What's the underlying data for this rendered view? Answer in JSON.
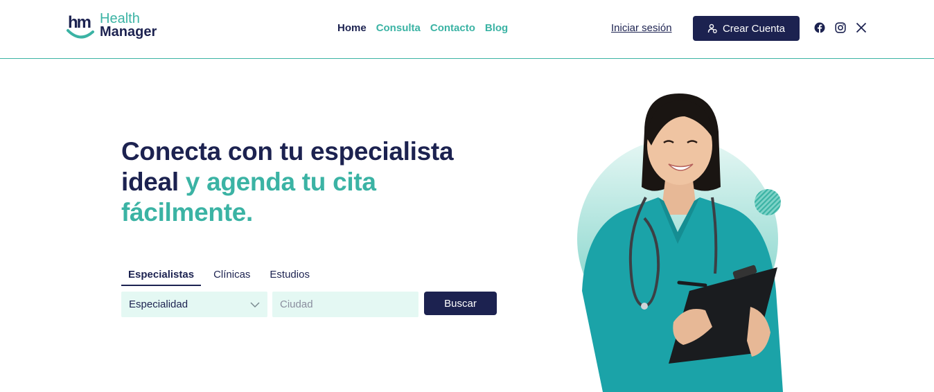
{
  "brand": {
    "line1": "Health",
    "line2": "Manager",
    "monogram": "hm"
  },
  "nav": {
    "items": [
      {
        "label": "Home",
        "active": true
      },
      {
        "label": "Consulta",
        "active": false
      },
      {
        "label": "Contacto",
        "active": false
      },
      {
        "label": "Blog",
        "active": false
      }
    ]
  },
  "auth": {
    "login_label": "Iniciar sesión",
    "signup_label": "Crear Cuenta",
    "signup_icon": "user-plus-icon"
  },
  "social": [
    {
      "name": "facebook-icon"
    },
    {
      "name": "instagram-icon"
    },
    {
      "name": "x-icon"
    }
  ],
  "hero": {
    "title_part1": "Conecta con tu especialista ideal",
    "title_part2": " y agenda tu cita fácilmente."
  },
  "search": {
    "tabs": [
      {
        "label": "Especialistas",
        "active": true
      },
      {
        "label": "Clínicas",
        "active": false
      },
      {
        "label": "Estudios",
        "active": false
      }
    ],
    "specialty_value": "Especialidad",
    "city_placeholder": "Ciudad",
    "button_label": "Buscar"
  },
  "colors": {
    "primary": "#1c2250",
    "accent": "#3bb3a4",
    "field_bg": "#e4f8f3",
    "scrubs": "#1ba3a8"
  }
}
